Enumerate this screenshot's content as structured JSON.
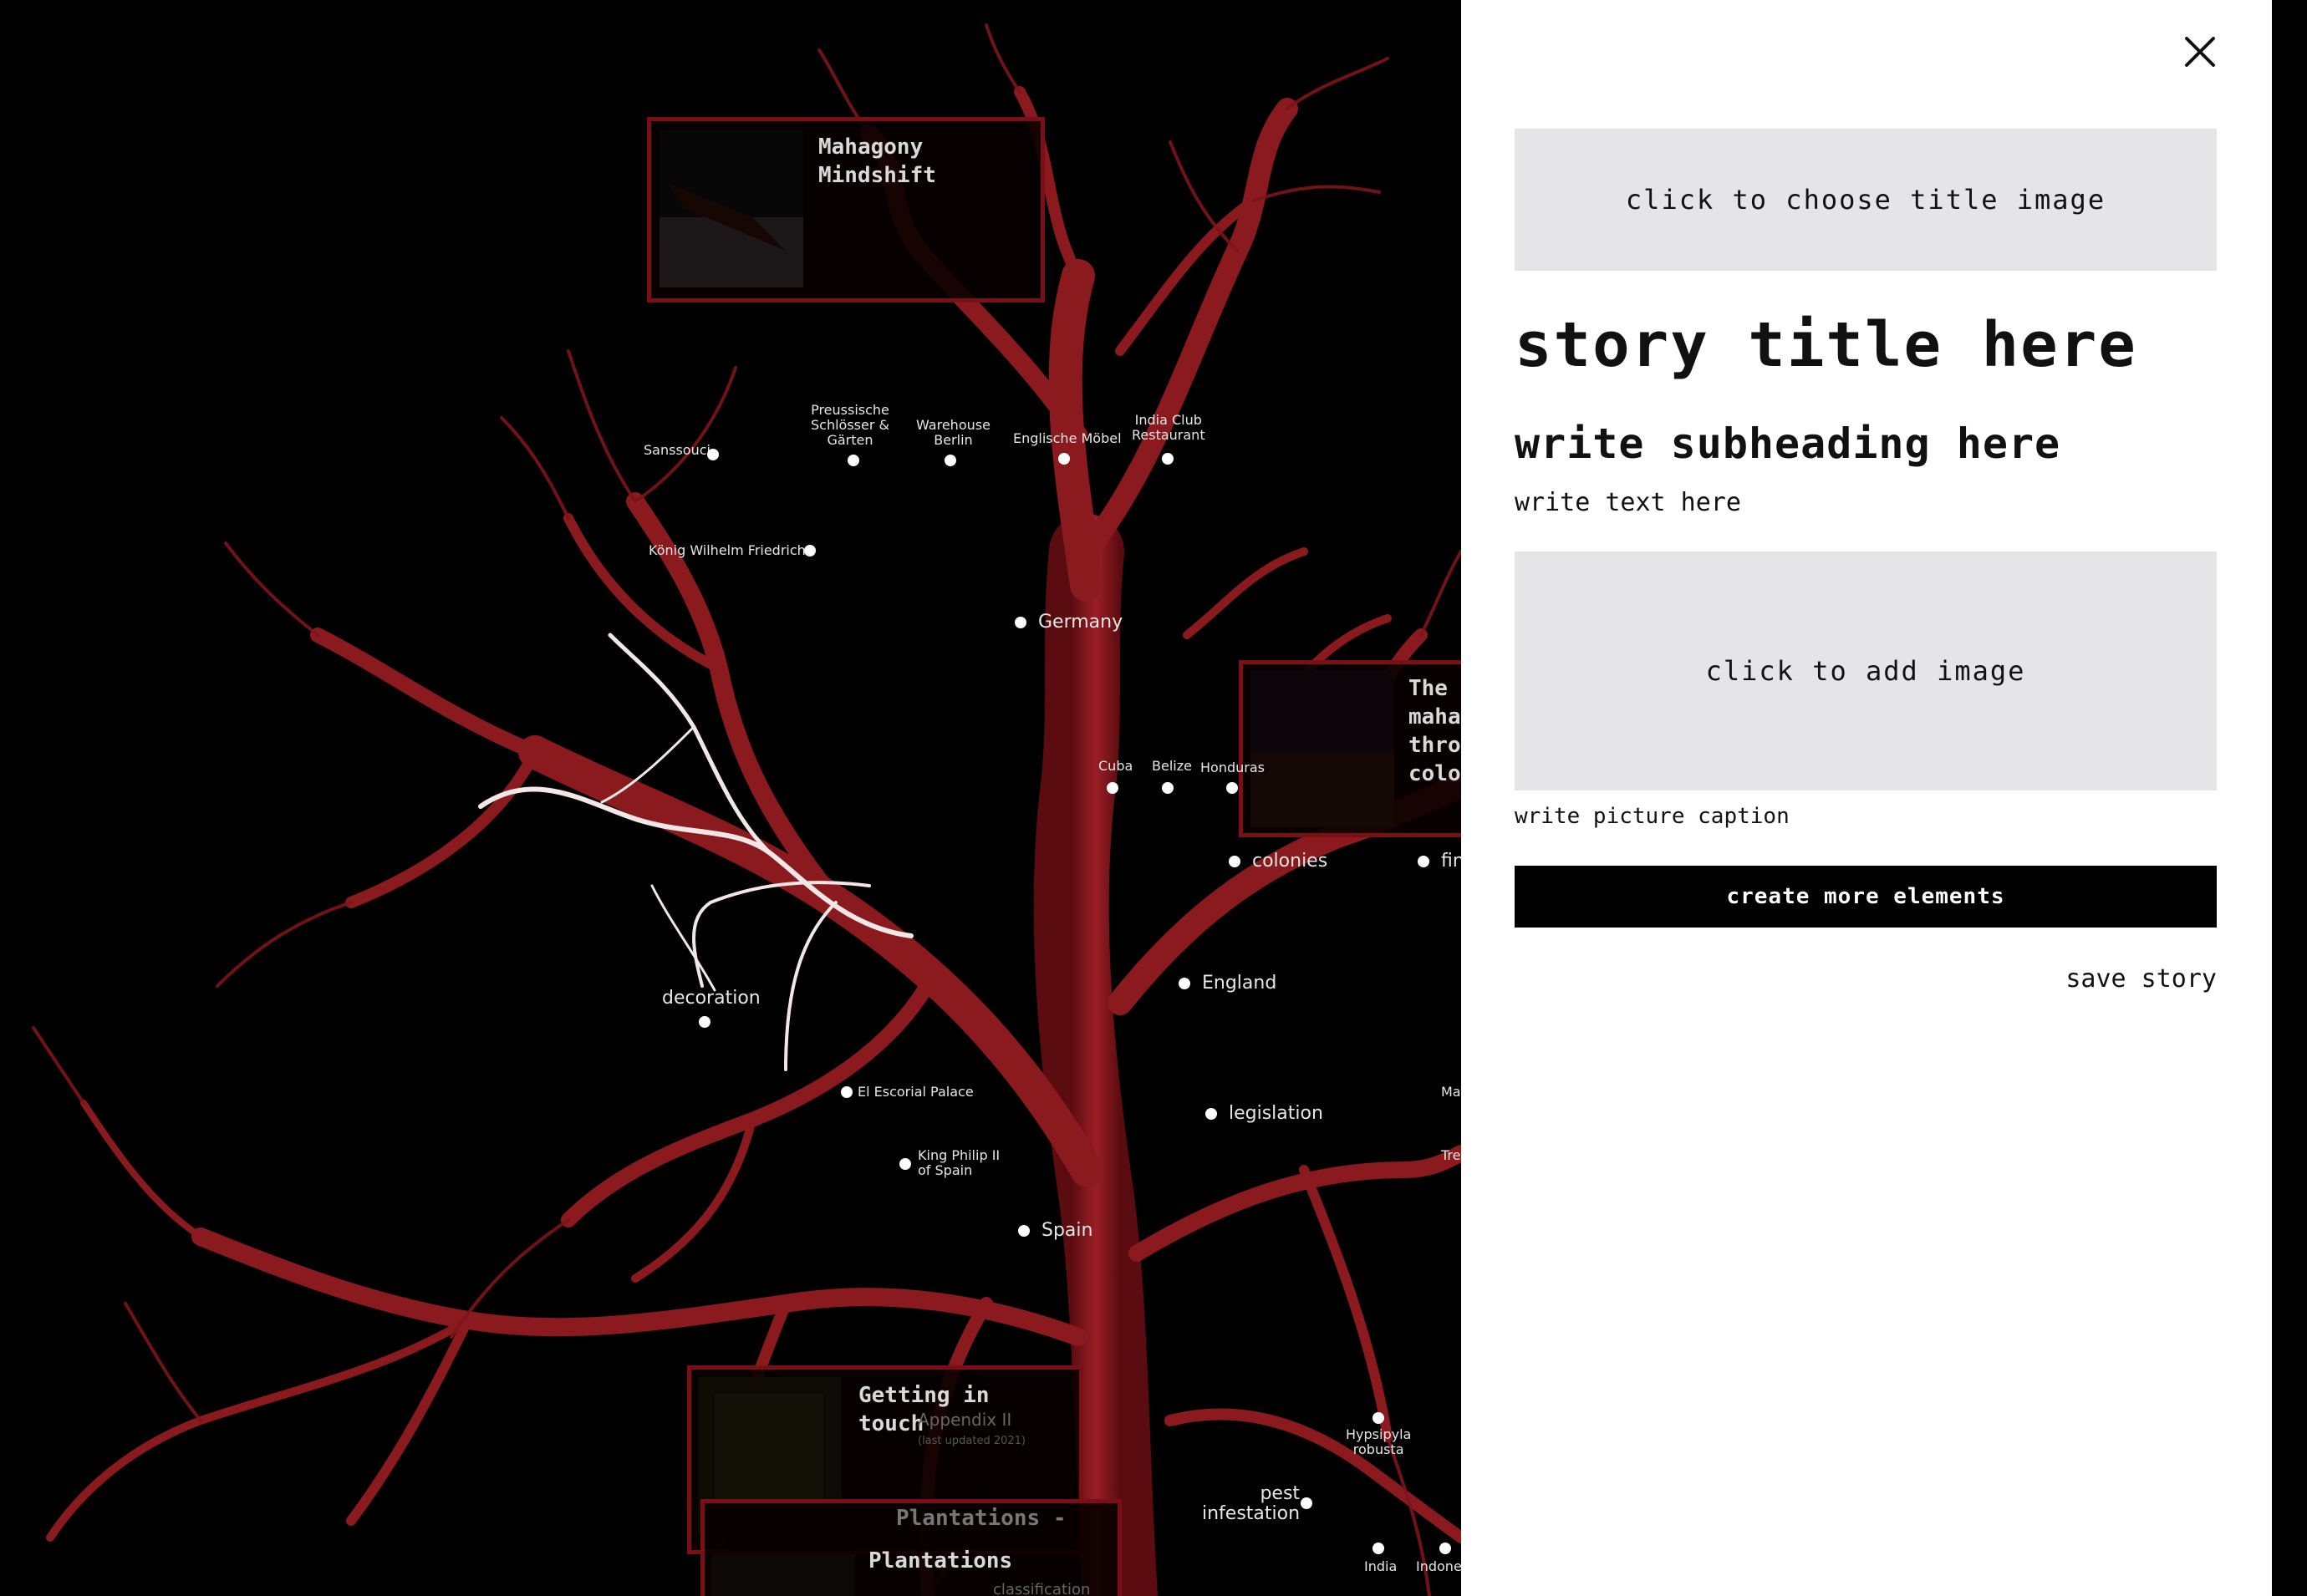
{
  "colors": {
    "branch": "#8b1a1f",
    "branch_light": "#b02a2e",
    "card_border": "#7a1016",
    "highlight": "#f2e6e6",
    "panel_bg": "#ffffff",
    "placeholder_bg": "#e5e4e6"
  },
  "cards": [
    {
      "title": "Mahagony\nMindshift",
      "thumb": "boat-photo"
    },
    {
      "title": "The\nmaha\nthro\ncolo",
      "thumb": "interior-photo"
    },
    {
      "title": "Getting in\ntouch",
      "thumb": "plant-photo"
    },
    {
      "title": "Plantations",
      "thumb": "forest-photo"
    }
  ],
  "ghost_labels": {
    "plantations_dim": "Plantations -",
    "appendix": "Appendix II",
    "appendix_note": "(last updated 2021)",
    "classification": "classification"
  },
  "nodes": {
    "sanssouci": "Sanssouci",
    "preussische": "Preussische\nSchlösser &\nGärten",
    "warehouse": "Warehouse\nBerlin",
    "englische": "Englische Möbel",
    "india_club": "India Club\nRestaurant",
    "koenig": "König Wilhelm Friedrich",
    "germany": "Germany",
    "cuba": "Cuba",
    "belize": "Belize",
    "honduras": "Honduras",
    "colonies": "colonies",
    "fin": "fin",
    "england": "England",
    "decoration": "decoration",
    "escorial": "El Escorial Palace",
    "philip": "King Philip II\nof Spain",
    "legislation": "legislation",
    "ma": "Ma",
    "tre": "Tre",
    "spain": "Spain",
    "hypsipyla": "Hypsipyla\nrobusta",
    "pest": "pest\ninfestation",
    "india": "India",
    "indonesia": "Indones"
  },
  "panel": {
    "title_image_prompt": "click to choose title image",
    "story_title": "story title here",
    "subheading": "write subheading here",
    "body_text": "write text here",
    "add_image_prompt": "click to add image",
    "caption": "write picture caption",
    "more_button": "create more elements",
    "save_button": "save story"
  }
}
